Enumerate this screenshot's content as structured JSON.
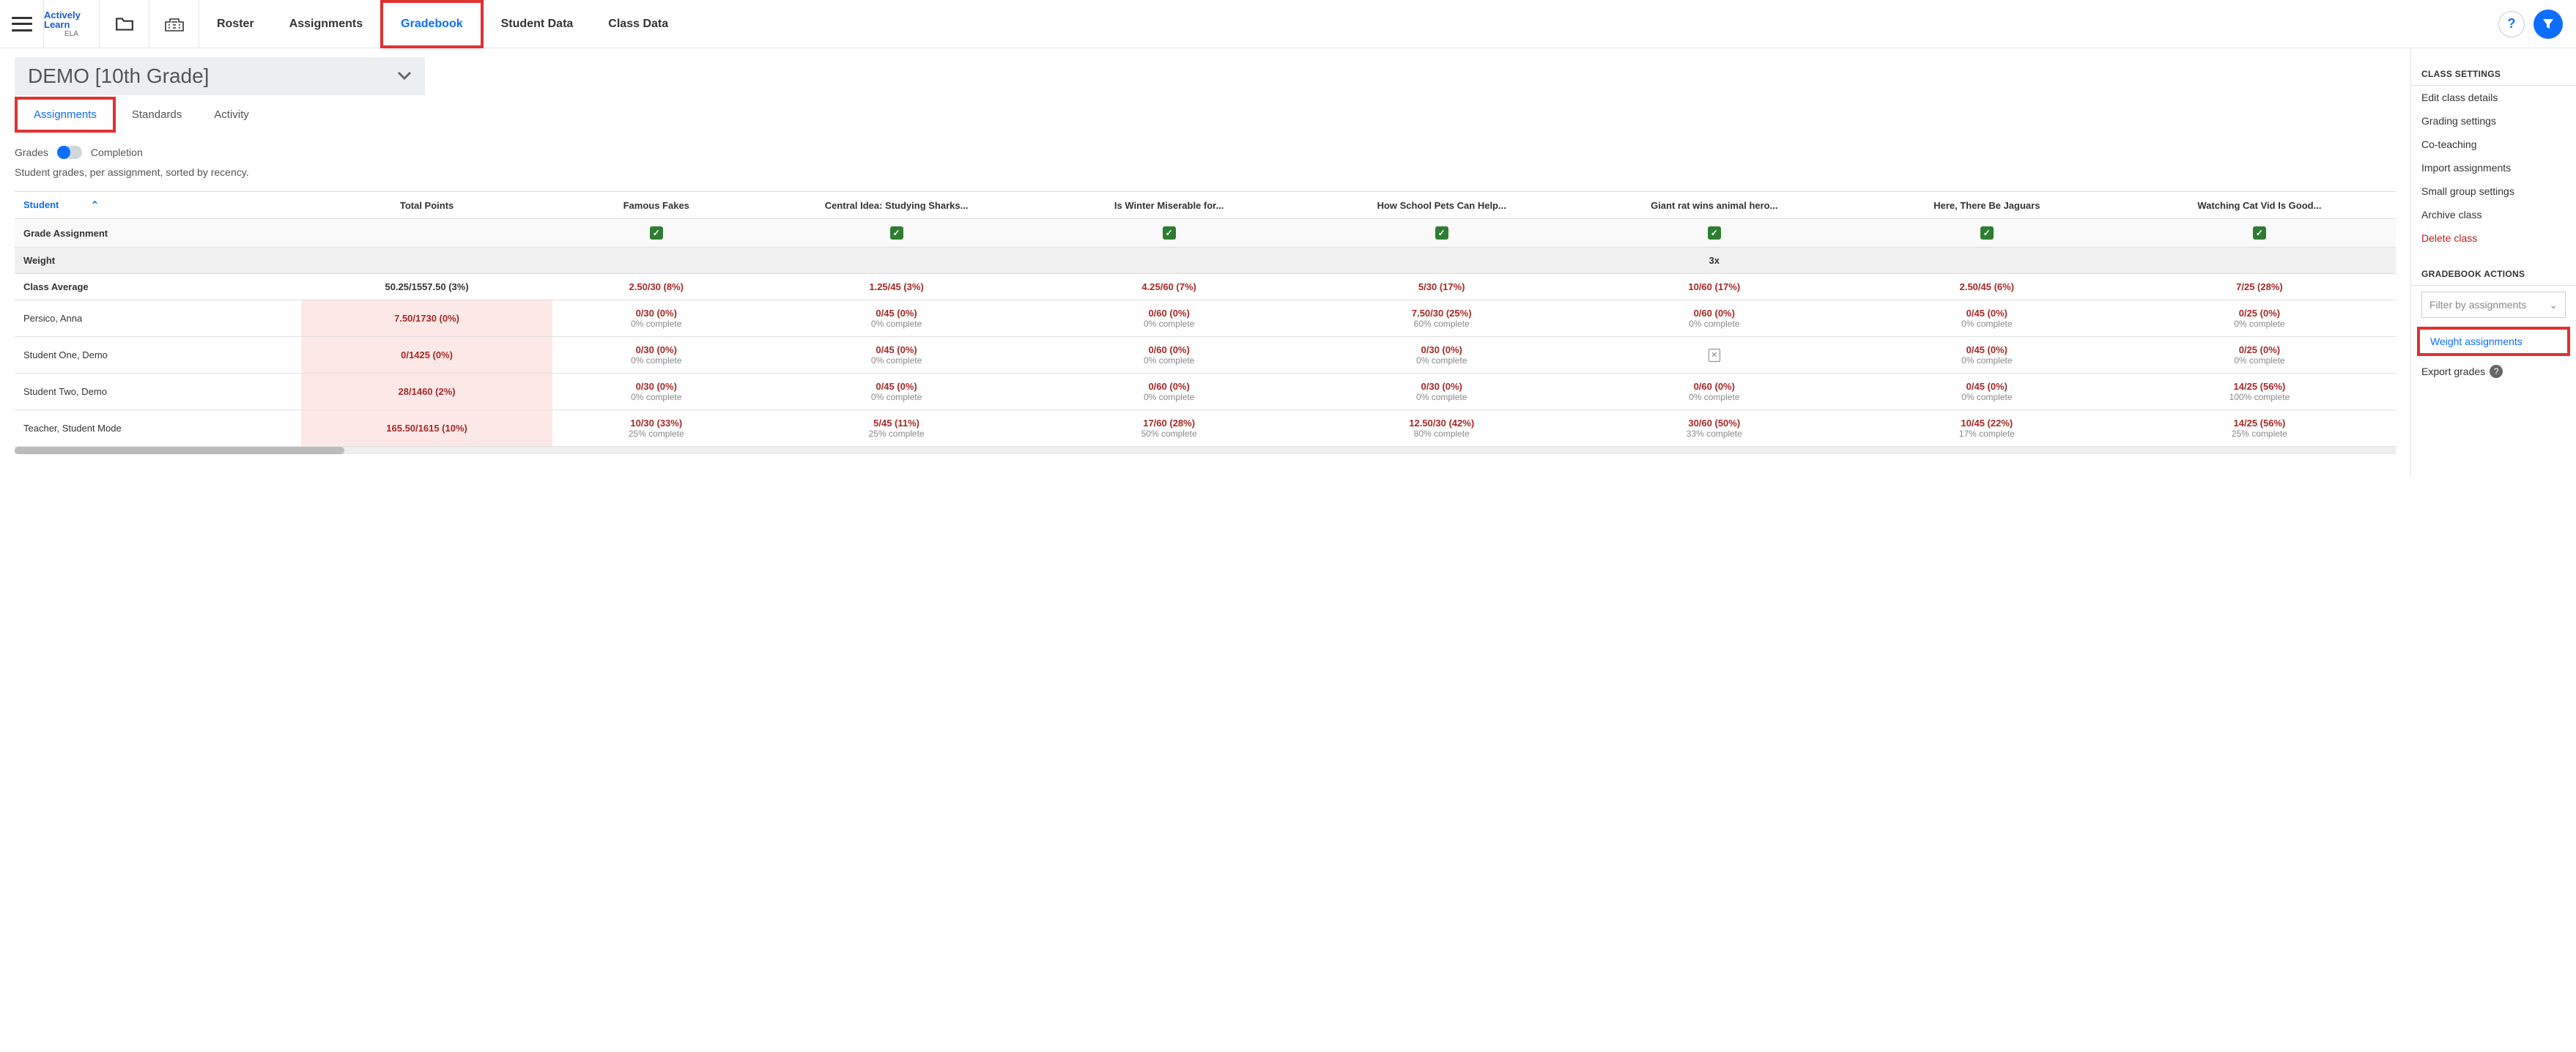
{
  "brand": {
    "name": "Actively Learn",
    "sub": "ELA"
  },
  "nav": {
    "roster": "Roster",
    "assignments": "Assignments",
    "gradebook": "Gradebook",
    "student_data": "Student Data",
    "class_data": "Class Data"
  },
  "class_name": "DEMO [10th Grade]",
  "subtabs": {
    "assignments": "Assignments",
    "standards": "Standards",
    "activity": "Activity"
  },
  "toggle": {
    "left": "Grades",
    "right": "Completion"
  },
  "description": "Student grades, per assignment, sorted by recency.",
  "columns": {
    "student": "Student",
    "total": "Total Points",
    "assignments": [
      "Famous Fakes",
      "Central Idea: Studying Sharks...",
      "Is Winter Miserable for...",
      "How School Pets Can Help...",
      "Giant rat wins animal hero...",
      "Here, There Be Jaguars",
      "Watching Cat Vid Is Good..."
    ]
  },
  "rows_labels": {
    "grade_assignment": "Grade Assignment",
    "weight": "Weight",
    "class_average": "Class Average"
  },
  "weight_value": "3x",
  "class_average": {
    "total": "50.25/1557.50 (3%)",
    "cells": [
      "2.50/30 (8%)",
      "1.25/45 (3%)",
      "4.25/60 (7%)",
      "5/30 (17%)",
      "10/60 (17%)",
      "2.50/45 (6%)",
      "7/25 (28%)"
    ]
  },
  "students": [
    {
      "name": "Persico, Anna",
      "total": "7.50/1730 (0%)",
      "cells": [
        {
          "main": "0/30 (0%)",
          "sub": "0% complete"
        },
        {
          "main": "0/45 (0%)",
          "sub": "0% complete"
        },
        {
          "main": "0/60 (0%)",
          "sub": "0% complete"
        },
        {
          "main": "7.50/30 (25%)",
          "sub": "60% complete"
        },
        {
          "main": "0/60 (0%)",
          "sub": "0% complete"
        },
        {
          "main": "0/45 (0%)",
          "sub": "0% complete"
        },
        {
          "main": "0/25 (0%)",
          "sub": "0% complete"
        }
      ]
    },
    {
      "name": "Student One, Demo",
      "total": "0/1425 (0%)",
      "cells": [
        {
          "main": "0/30 (0%)",
          "sub": "0% complete"
        },
        {
          "main": "0/45 (0%)",
          "sub": "0% complete"
        },
        {
          "main": "0/60 (0%)",
          "sub": "0% complete"
        },
        {
          "main": "0/30 (0%)",
          "sub": "0% complete"
        },
        {
          "main": "",
          "sub": "",
          "icon": "x"
        },
        {
          "main": "0/45 (0%)",
          "sub": "0% complete"
        },
        {
          "main": "0/25 (0%)",
          "sub": "0% complete"
        }
      ]
    },
    {
      "name": "Student Two, Demo",
      "total": "28/1460 (2%)",
      "cells": [
        {
          "main": "0/30 (0%)",
          "sub": "0% complete"
        },
        {
          "main": "0/45 (0%)",
          "sub": "0% complete"
        },
        {
          "main": "0/60 (0%)",
          "sub": "0% complete"
        },
        {
          "main": "0/30 (0%)",
          "sub": "0% complete"
        },
        {
          "main": "0/60 (0%)",
          "sub": "0% complete"
        },
        {
          "main": "0/45 (0%)",
          "sub": "0% complete"
        },
        {
          "main": "14/25 (56%)",
          "sub": "100% complete"
        }
      ]
    },
    {
      "name": "Teacher, Student Mode",
      "total": "165.50/1615 (10%)",
      "cells": [
        {
          "main": "10/30 (33%)",
          "sub": "25% complete"
        },
        {
          "main": "5/45 (11%)",
          "sub": "25% complete"
        },
        {
          "main": "17/60 (28%)",
          "sub": "50% complete"
        },
        {
          "main": "12.50/30 (42%)",
          "sub": "80% complete"
        },
        {
          "main": "30/60 (50%)",
          "sub": "33% complete"
        },
        {
          "main": "10/45 (22%)",
          "sub": "17% complete"
        },
        {
          "main": "14/25 (56%)",
          "sub": "25% complete"
        }
      ]
    }
  ],
  "sidebar": {
    "class_settings": "CLASS SETTINGS",
    "links_settings": [
      "Edit class details",
      "Grading settings",
      "Co-teaching",
      "Import assignments",
      "Small group settings",
      "Archive class"
    ],
    "delete_class": "Delete class",
    "gradebook_actions": "GRADEBOOK ACTIONS",
    "filter_placeholder": "Filter by assignments",
    "weight_assignments": "Weight assignments",
    "export_grades": "Export grades"
  }
}
